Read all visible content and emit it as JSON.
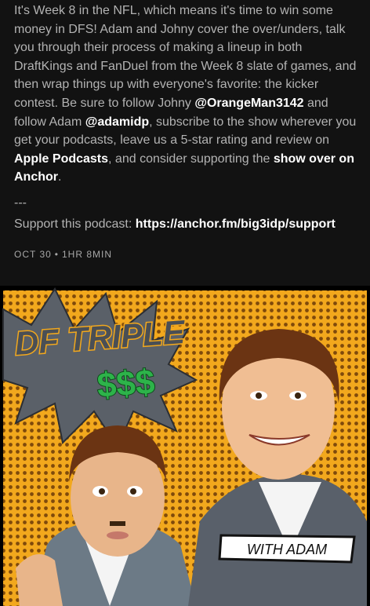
{
  "episode": {
    "description": {
      "t1": "It's Week 8 in the NFL, which means it's time to win some money in DFS! Adam and Johny cover the over/unders, talk you through their process of making a lineup in both DraftKings and FanDuel from the Week 8 slate of games, and then wrap things up with everyone's favorite: the kicker contest. Be sure to follow Johny ",
      "handle_johny": "@OrangeMan3142",
      "t2": " and follow Adam ",
      "handle_adam": "@adamidp",
      "t3": ", subscribe to the show wherever you get your podcasts, leave us a 5-star rating and review on ",
      "apple_podcasts": "Apple Podcasts",
      "t4": ", and consider supporting the ",
      "anchor_link": "show over on Anchor",
      "t5": "."
    },
    "separator": "---",
    "support_label": "Support this podcast: ",
    "support_url": "https://anchor.fm/big3idp/support",
    "date": "OCT 30",
    "dot": "•",
    "duration": "1HR 8MIN"
  },
  "artwork": {
    "title_line1": "DF TRIPLE",
    "title_line2": "$$$",
    "badge": "WITH ADAM",
    "colors": {
      "background": "#f2a81d",
      "title": "#4a4f55",
      "money": "#2db34a"
    }
  }
}
